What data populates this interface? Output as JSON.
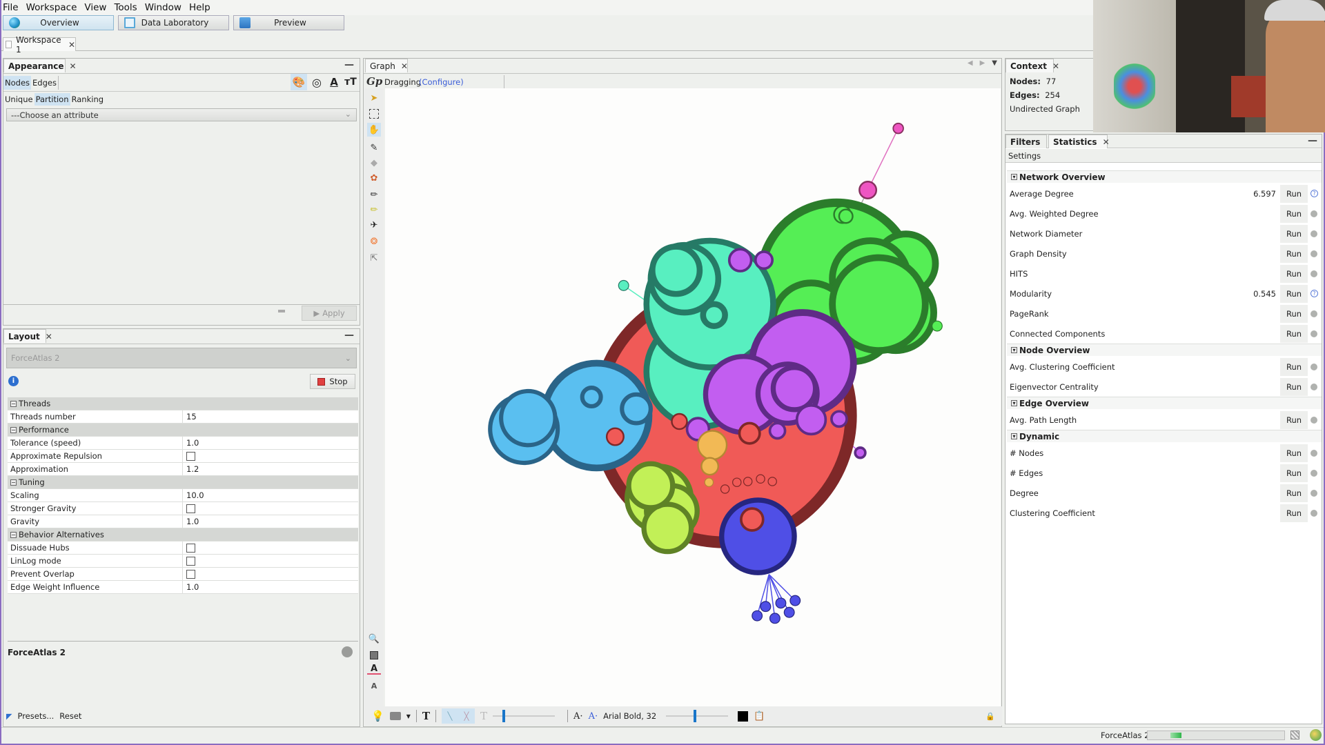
{
  "menu": [
    "File",
    "Workspace",
    "View",
    "Tools",
    "Window",
    "Help"
  ],
  "perspectives": [
    {
      "label": "Overview",
      "active": true
    },
    {
      "label": "Data Laboratory",
      "active": false
    },
    {
      "label": "Preview",
      "active": false
    }
  ],
  "workspace_tab": "Workspace 1",
  "appearance": {
    "title": "Appearance",
    "element_tabs": [
      "Nodes",
      "Edges"
    ],
    "selected_element_tab": "Nodes",
    "transform_icons": [
      "color-palette-icon",
      "size-icon",
      "label-color-icon",
      "label-size-icon"
    ],
    "mode_tabs": [
      "Unique",
      "Partition",
      "Ranking"
    ],
    "selected_mode_tab": "Partition",
    "attribute_dropdown": "---Choose an attribute",
    "apply_label": "Apply"
  },
  "layout": {
    "title": "Layout",
    "algorithm": "ForceAtlas 2",
    "stop_label": "Stop",
    "properties": [
      {
        "type": "category",
        "label": "Threads"
      },
      {
        "label": "Threads number",
        "value": "15"
      },
      {
        "type": "category",
        "label": "Performance"
      },
      {
        "label": "Tolerance (speed)",
        "value": "1.0"
      },
      {
        "label": "Approximate Repulsion",
        "checkbox": false
      },
      {
        "label": "Approximation",
        "value": "1.2"
      },
      {
        "type": "category",
        "label": "Tuning"
      },
      {
        "label": "Scaling",
        "value": "10.0"
      },
      {
        "label": "Stronger Gravity",
        "checkbox": false
      },
      {
        "label": "Gravity",
        "value": "1.0"
      },
      {
        "type": "category",
        "label": "Behavior Alternatives"
      },
      {
        "label": "Dissuade Hubs",
        "checkbox": false
      },
      {
        "label": "LinLog mode",
        "checkbox": false
      },
      {
        "label": "Prevent Overlap",
        "checkbox": false
      },
      {
        "label": "Edge Weight Influence",
        "value": "1.0"
      }
    ],
    "description_title": "ForceAtlas 2",
    "presets_label": "Presets...",
    "reset_label": "Reset"
  },
  "graph": {
    "title": "Graph",
    "mode_label": "Dragging",
    "configure_label": "(Configure)",
    "font_label": "Arial Bold, 32",
    "text_color": "#000000"
  },
  "context": {
    "title": "Context",
    "nodes_label": "Nodes:",
    "nodes_value": "77",
    "edges_label": "Edges:",
    "edges_value": "254",
    "graph_type": "Undirected Graph"
  },
  "statistics": {
    "tabs": [
      "Filters",
      "Statistics"
    ],
    "active_tab": "Statistics",
    "settings_label": "Settings",
    "run_label": "Run",
    "sections": [
      {
        "title": "Network Overview",
        "items": [
          {
            "name": "Average Degree",
            "value": "6.597"
          },
          {
            "name": "Avg. Weighted Degree",
            "value": ""
          },
          {
            "name": "Network Diameter",
            "value": ""
          },
          {
            "name": "Graph Density",
            "value": ""
          },
          {
            "name": "HITS",
            "value": ""
          },
          {
            "name": "Modularity",
            "value": "0.545"
          },
          {
            "name": "PageRank",
            "value": ""
          },
          {
            "name": "Connected Components",
            "value": ""
          }
        ]
      },
      {
        "title": "Node Overview",
        "items": [
          {
            "name": "Avg. Clustering Coefficient",
            "value": ""
          },
          {
            "name": "Eigenvector Centrality",
            "value": ""
          }
        ]
      },
      {
        "title": "Edge Overview",
        "items": [
          {
            "name": "Avg. Path Length",
            "value": ""
          }
        ]
      },
      {
        "title": "Dynamic",
        "items": [
          {
            "name": "# Nodes",
            "value": ""
          },
          {
            "name": "# Edges",
            "value": ""
          },
          {
            "name": "Degree",
            "value": ""
          },
          {
            "name": "Clustering Coefficient",
            "value": ""
          }
        ]
      }
    ]
  },
  "status": {
    "task_label": "ForceAtlas 2",
    "progress": "indeterminate"
  },
  "communities": [
    {
      "name": "red",
      "fill": "#f05a57",
      "stroke": "#7e2828"
    },
    {
      "name": "green",
      "fill": "#55ee55",
      "stroke": "#2b7d2b"
    },
    {
      "name": "teal",
      "fill": "#58efc0",
      "stroke": "#267a66"
    },
    {
      "name": "purple",
      "fill": "#c25ef0",
      "stroke": "#5f2b86"
    },
    {
      "name": "blue",
      "fill": "#5abff0",
      "stroke": "#2a6488"
    },
    {
      "name": "lime",
      "fill": "#c2f057",
      "stroke": "#5f8226"
    },
    {
      "name": "indigo",
      "fill": "#4f4fe6",
      "stroke": "#262680"
    },
    {
      "name": "orange",
      "fill": "#f2b955",
      "stroke": "#b48833"
    },
    {
      "name": "pink",
      "fill": "#ee55c2",
      "stroke": "#87305f"
    }
  ]
}
